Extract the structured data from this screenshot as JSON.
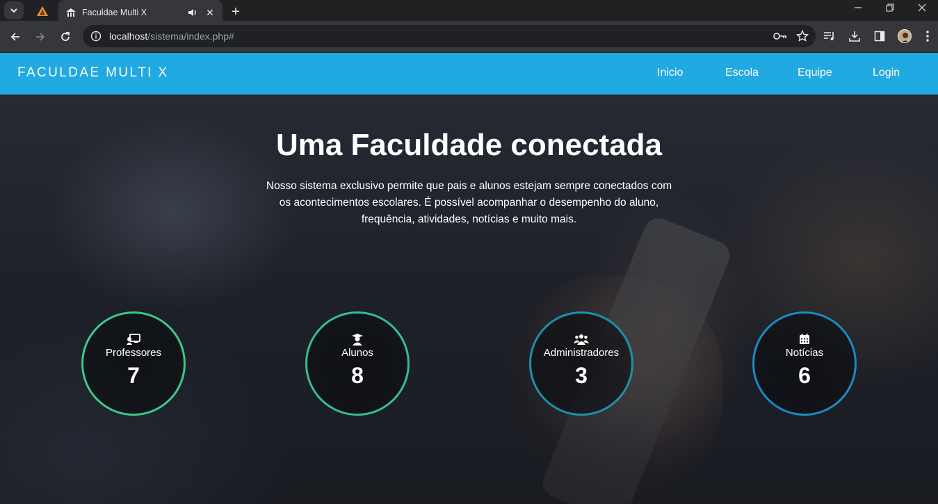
{
  "browser": {
    "tab_title": "Faculdae Multi X",
    "url_host": "localhost",
    "url_path": "/sistema/index.php#"
  },
  "site": {
    "brand": "Faculdae Multi X",
    "nav": [
      "Inicio",
      "Escola",
      "Equipe",
      "Login"
    ],
    "accent_color": "#21a9e1"
  },
  "hero": {
    "title": "Uma Faculdade conectada",
    "text": "Nosso sistema exclusivo permite que pais e alunos estejam sempre conectados com os acontecimentos escolares. É possível acompanhar o desempenho do aluno, frequência, atividades, notícias e muito mais."
  },
  "stats": [
    {
      "label": "Professores",
      "value": "7",
      "icon": "chalkboard-teacher-icon",
      "color": "#3cc88a"
    },
    {
      "label": "Alunos",
      "value": "8",
      "icon": "graduate-icon",
      "color": "#35bd95"
    },
    {
      "label": "Administradores",
      "value": "3",
      "icon": "users-icon",
      "color": "#1a93a8"
    },
    {
      "label": "Notícias",
      "value": "6",
      "icon": "calendar-icon",
      "color": "#1a8bc4"
    }
  ]
}
